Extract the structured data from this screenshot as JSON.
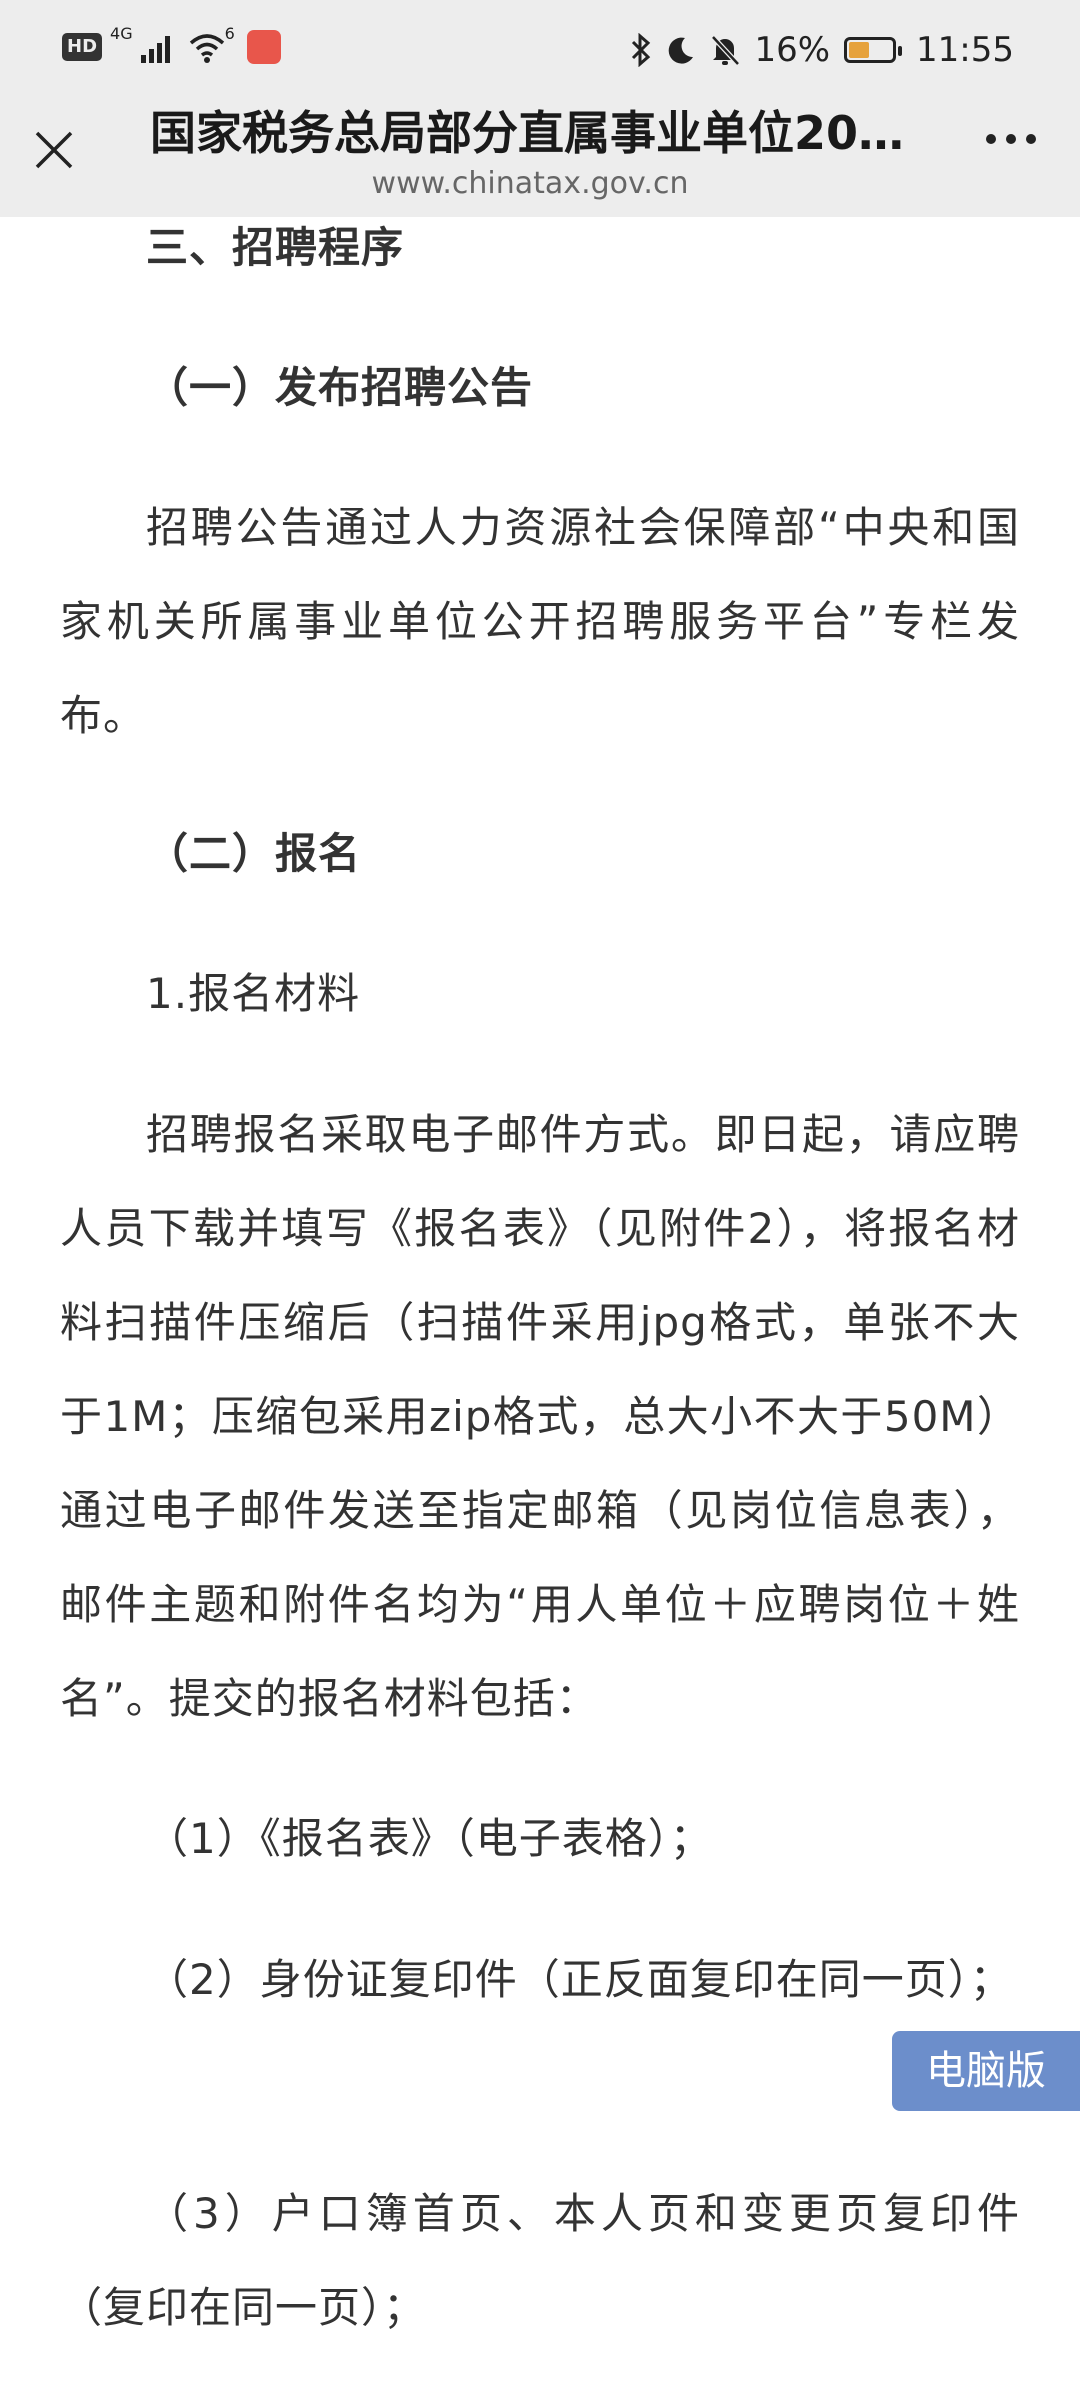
{
  "status_bar": {
    "hd": "HD",
    "network_4g": "4G",
    "wifi_6": "6",
    "battery": "16%",
    "time": "11:55"
  },
  "navbar": {
    "title": "国家税务总局部分直属事业单位202…",
    "url": "www.chinatax.gov.cn"
  },
  "article": {
    "section_heading": "三、招聘程序",
    "sub1_heading": "（一）发布招聘公告",
    "sub1_body": "招聘公告通过人力资源社会保障部“中央和国家机关所属事业单位公开招聘服务平台”专栏发布。",
    "sub2_heading": "（二）报名",
    "item1_heading": "1.报名材料",
    "item1_body": "招聘报名采取电子邮件方式。即日起，请应聘人员下载并填写《报名表》（见附件2），将报名材料扫描件压缩后（扫描件采用jpg格式，单张不大于1M；压缩包采用zip格式，总大小不大于50M）通过电子邮件发送至指定邮箱（见岗位信息表），邮件主题和附件名均为“用人单位＋应聘岗位＋姓名”。提交的报名材料包括：",
    "material_1": "（1）《报名表》（电子表格）；",
    "material_2": "（2）身份证复印件（正反面复印在同一页）；",
    "material_3": "（3）户口簿首页、本人页和变更页复印件（复印在同一页）；"
  },
  "desktop_version_label": "电脑版",
  "colors": {
    "topbar_bg": "#ededed",
    "desktop_button_bg": "#6c8ecb",
    "battery_fill": "#e6a23c",
    "app_badge": "#e8564b"
  }
}
